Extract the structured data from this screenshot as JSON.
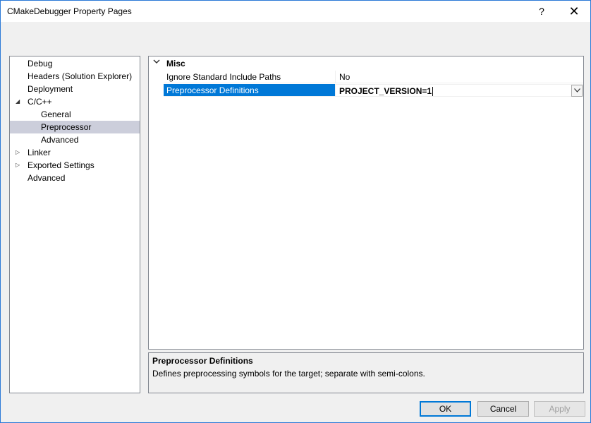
{
  "window": {
    "title": "CMakeDebugger Property Pages",
    "help_label": "?",
    "close_label": "✕"
  },
  "tree": {
    "items": [
      {
        "label": "Debug"
      },
      {
        "label": "Headers (Solution Explorer)"
      },
      {
        "label": "Deployment"
      },
      {
        "label": "C/C++",
        "expanded": true
      },
      {
        "label": "General"
      },
      {
        "label": "Preprocessor",
        "selected": true
      },
      {
        "label": "Advanced"
      },
      {
        "label": "Linker",
        "expanded": false
      },
      {
        "label": "Exported Settings",
        "expanded": false
      },
      {
        "label": "Advanced"
      }
    ]
  },
  "grid": {
    "category": "Misc",
    "rows": [
      {
        "name": "Ignore Standard Include Paths",
        "value": "No"
      },
      {
        "name": "Preprocessor Definitions",
        "value": "PROJECT_VERSION=1",
        "selected": true
      }
    ]
  },
  "description": {
    "title": "Preprocessor Definitions",
    "text": "Defines preprocessing symbols for the target; separate with semi-colons."
  },
  "buttons": {
    "ok": "OK",
    "cancel": "Cancel",
    "apply": "Apply"
  },
  "colors": {
    "accent": "#0078d7",
    "tree_selected": "#cccedb",
    "border": "#828790"
  },
  "icons": {
    "expanded": "triangle-down-right",
    "collapsed": "triangle-right",
    "category_toggle": "chevron-down",
    "dropdown": "chevron-down"
  }
}
